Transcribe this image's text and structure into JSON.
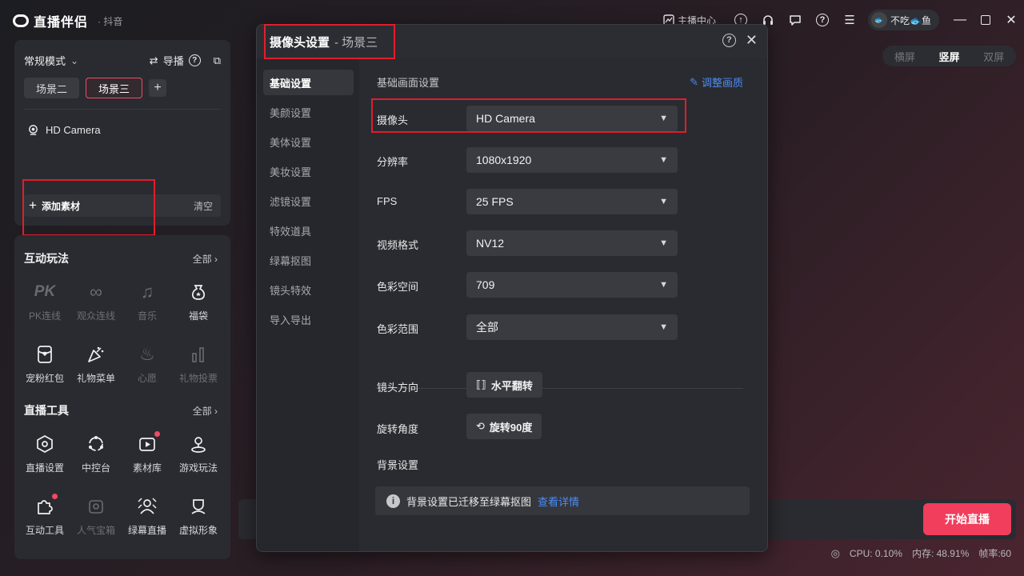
{
  "app": {
    "name": "直播伴侣",
    "platform": "· 抖音"
  },
  "titlebar": {
    "anchor_center": "主播中心",
    "user_name": "不吃🐟鱼",
    "icons": [
      "upload-icon",
      "headset-icon",
      "chat-icon",
      "help-icon",
      "menu-icon"
    ]
  },
  "left_top": {
    "mode": "常规模式",
    "guide": "导播",
    "scenes": [
      "场景二",
      "场景三"
    ],
    "active_scene": "场景三",
    "source": "HD Camera",
    "add_material": "添加素材",
    "clear": "清空"
  },
  "interactive": {
    "title": "互动玩法",
    "all": "全部",
    "tiles": [
      {
        "label": "PK连线",
        "icon": "pk-icon",
        "enabled": false
      },
      {
        "label": "观众连线",
        "icon": "audience-link-icon",
        "enabled": false
      },
      {
        "label": "音乐",
        "icon": "music-icon",
        "enabled": false
      },
      {
        "label": "福袋",
        "icon": "lucky-bag-icon",
        "enabled": true
      },
      {
        "label": "宠粉红包",
        "icon": "red-packet-icon",
        "enabled": true
      },
      {
        "label": "礼物菜单",
        "icon": "gift-menu-icon",
        "enabled": true
      },
      {
        "label": "心愿",
        "icon": "wish-icon",
        "enabled": false
      },
      {
        "label": "礼物投票",
        "icon": "gift-vote-icon",
        "enabled": false
      }
    ]
  },
  "tools": {
    "title": "直播工具",
    "all": "全部",
    "tiles": [
      {
        "label": "直播设置",
        "icon": "live-settings-icon",
        "enabled": true
      },
      {
        "label": "中控台",
        "icon": "console-icon",
        "enabled": true
      },
      {
        "label": "素材库",
        "icon": "material-library-icon",
        "enabled": true
      },
      {
        "label": "游戏玩法",
        "icon": "game-icon",
        "enabled": true
      },
      {
        "label": "互动工具",
        "icon": "interactive-tools-icon",
        "enabled": true
      },
      {
        "label": "人气宝箱",
        "icon": "treasure-box-icon",
        "enabled": false
      },
      {
        "label": "绿幕直播",
        "icon": "green-screen-icon",
        "enabled": true
      },
      {
        "label": "虚拟形象",
        "icon": "avatar-icon",
        "enabled": true
      }
    ]
  },
  "orientation": {
    "options": [
      "横屏",
      "竖屏",
      "双屏"
    ],
    "active": "竖屏"
  },
  "start_live": "开始直播",
  "stats": {
    "cpu": "CPU: 0.10%",
    "memory": "内存: 48.91%",
    "fps": "帧率:60"
  },
  "modal": {
    "title": "摄像头设置",
    "subtitle": "- 场景三",
    "nav": [
      "基础设置",
      "美颜设置",
      "美体设置",
      "美妆设置",
      "滤镜设置",
      "特效道具",
      "绿幕抠图",
      "镜头特效",
      "导入导出"
    ],
    "active_nav": "基础设置",
    "section_title": "基础画面设置",
    "adjust_quality": "调整画质",
    "fields": [
      {
        "label": "摄像头",
        "value": "HD Camera"
      },
      {
        "label": "分辨率",
        "value": "1080x1920"
      },
      {
        "label": "FPS",
        "value": "25 FPS"
      },
      {
        "label": "视频格式",
        "value": "NV12"
      },
      {
        "label": "色彩空间",
        "value": "709"
      },
      {
        "label": "色彩范围",
        "value": "全部"
      }
    ],
    "lens_direction": {
      "label": "镜头方向",
      "button": "水平翻转"
    },
    "rotation": {
      "label": "旋转角度",
      "button": "旋转90度"
    },
    "background": {
      "label": "背景设置",
      "notice": "背景设置已迁移至绿幕抠图",
      "link": "查看详情"
    }
  },
  "colors": {
    "accent": "#f03e5c",
    "link": "#4a8cf5",
    "highlight_box": "#e21d2d"
  }
}
